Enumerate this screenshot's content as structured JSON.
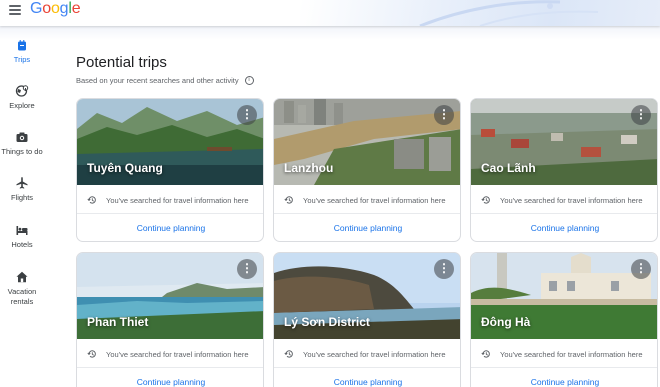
{
  "header": {
    "logo_text": "Google",
    "logo_colors": [
      "#4285F4",
      "#EA4335",
      "#FBBC05",
      "#4285F4",
      "#34A853",
      "#EA4335"
    ]
  },
  "sidebar": {
    "items": [
      {
        "label": "Trips",
        "icon": "suitcase-icon",
        "active": true
      },
      {
        "label": "Explore",
        "icon": "explore-globe-icon",
        "active": false
      },
      {
        "label": "Things to do",
        "icon": "camera-icon",
        "active": false
      },
      {
        "label": "Flights",
        "icon": "airplane-icon",
        "active": false
      },
      {
        "label": "Hotels",
        "icon": "bed-icon",
        "active": false
      },
      {
        "label": "Vacation rentals",
        "icon": "house-icon",
        "active": false
      }
    ]
  },
  "main": {
    "title": "Potential trips",
    "subtitle": "Based on your recent searches and other activity",
    "cards": [
      {
        "city": "Tuyên Quang",
        "history_text": "You've searched for travel information here",
        "cta": "Continue planning"
      },
      {
        "city": "Lanzhou",
        "history_text": "You've searched for travel information here",
        "cta": "Continue planning"
      },
      {
        "city": "Cao Lãnh",
        "history_text": "You've searched for travel information here",
        "cta": "Continue planning"
      },
      {
        "city": "Phan Thiet",
        "history_text": "You've searched for travel information here",
        "cta": "Continue planning"
      },
      {
        "city": "Lý Sơn District",
        "history_text": "You've searched for travel information here",
        "cta": "Continue planning"
      },
      {
        "city": "Đông Hà",
        "history_text": "You've searched for travel information here",
        "cta": "Continue planning"
      }
    ]
  },
  "colors": {
    "accent": "#1a73e8",
    "text": "#202124",
    "muted": "#5f6368",
    "border": "#dadce0"
  }
}
